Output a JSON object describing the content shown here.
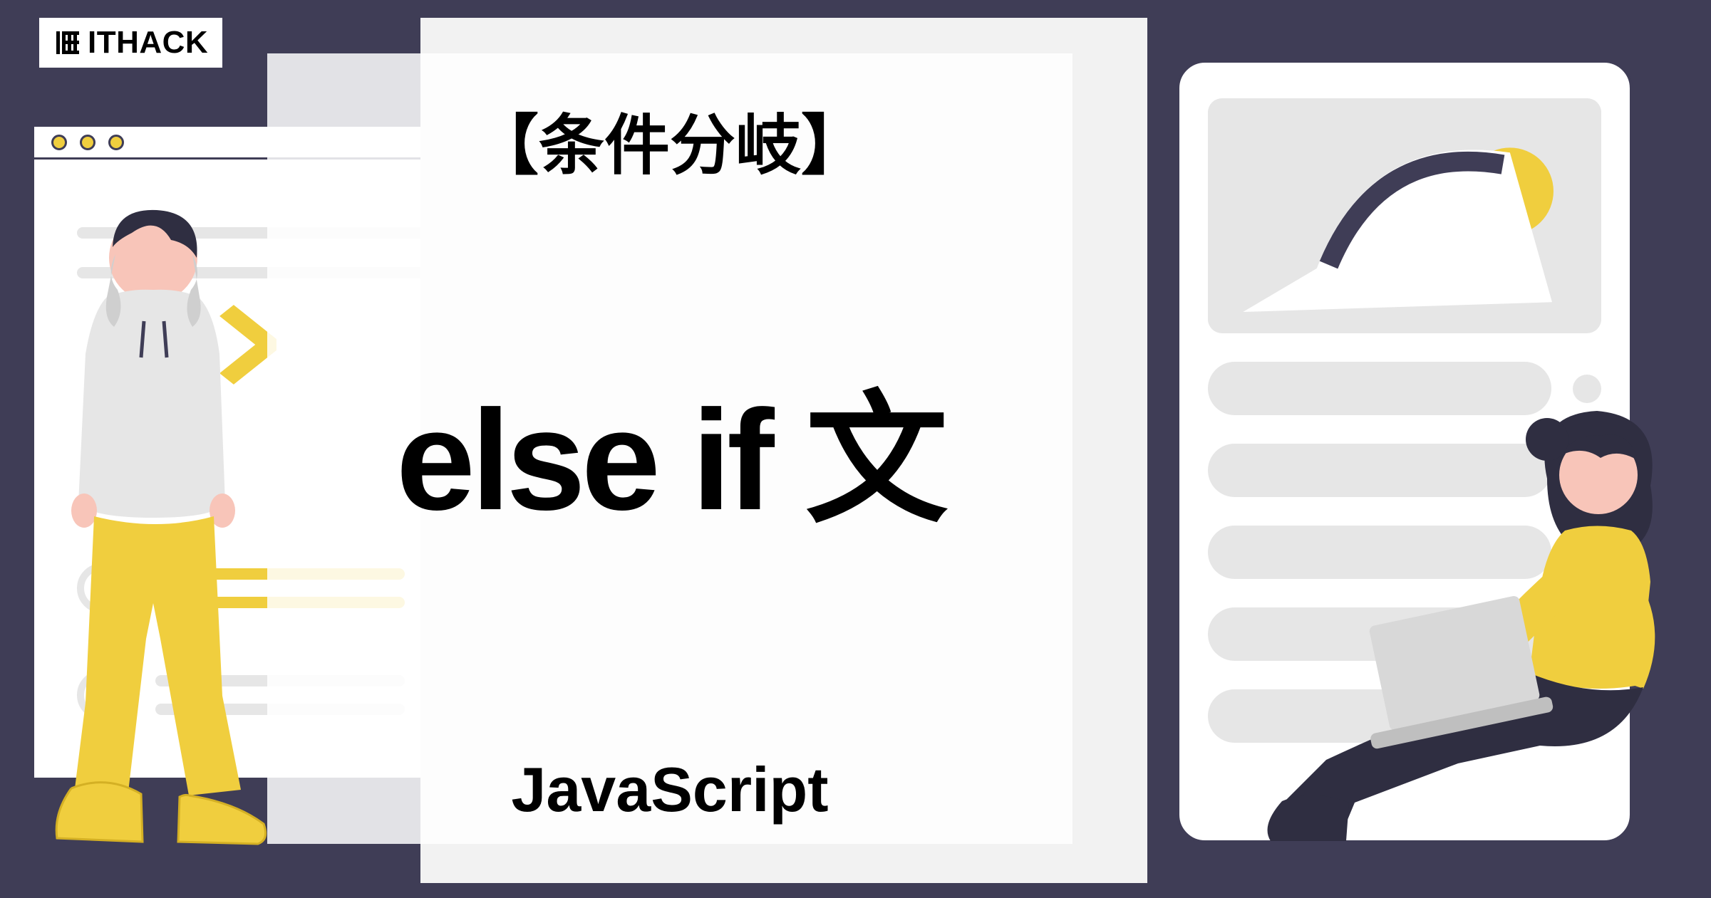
{
  "logo": {
    "text": "ITHACK"
  },
  "title": {
    "subtitle": "【条件分岐】",
    "main": "else if 文",
    "language": "JavaScript"
  },
  "colors": {
    "background": "#3f3d56",
    "accent": "#f0ce3e",
    "panel": "#f2f2f2",
    "neutral": "#e6e6e6"
  },
  "icons": {
    "code_bracket": "< >"
  }
}
